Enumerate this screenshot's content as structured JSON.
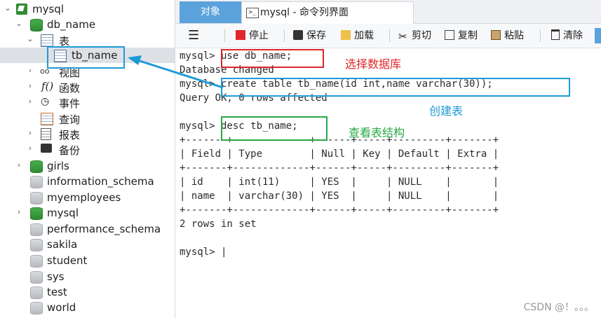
{
  "sidebar": {
    "connection": "mysql",
    "database": "db_name",
    "tables_group": "表",
    "table_item": "tb_name",
    "views": "视图",
    "functions": "函数",
    "events": "事件",
    "queries": "查询",
    "reports": "报表",
    "backups": "备份",
    "databases": [
      "girls",
      "information_schema",
      "myemployees",
      "mysql",
      "performance_schema",
      "sakila",
      "student",
      "sys",
      "test",
      "world"
    ]
  },
  "tabs": {
    "objects": "对象",
    "console": "mysql - 命令列界面"
  },
  "toolbar": {
    "stop": "停止",
    "save": "保存",
    "load": "加载",
    "cut": "剪切",
    "copy": "复制",
    "paste": "粘贴",
    "clear": "清除"
  },
  "console": {
    "lines": [
      "mysql> use db_name;",
      "Database changed",
      "mysql> create table tb_name(id int,name varchar(30));",
      "Query OK, 0 rows affected",
      "",
      "mysql> desc tb_name;",
      "+-------+-------------+------+-----+---------+-------+",
      "| Field | Type        | Null | Key | Default | Extra |",
      "+-------+-------------+------+-----+---------+-------+",
      "| id    | int(11)     | YES  |     | NULL    |       |",
      "| name  | varchar(30) | YES  |     | NULL    |       |",
      "+-------+-------------+------+-----+---------+-------+",
      "2 rows in set",
      "",
      "mysql> |"
    ]
  },
  "annotations": {
    "select_db": "选择数据库",
    "create_table": "创建表",
    "view_structure": "查看表结构"
  },
  "watermark": "CSDN @！。。。",
  "colors": {
    "red": "#e0262b",
    "blue": "#1e9bd7",
    "green": "#27a844",
    "tab_active": "#5aa2dc"
  }
}
